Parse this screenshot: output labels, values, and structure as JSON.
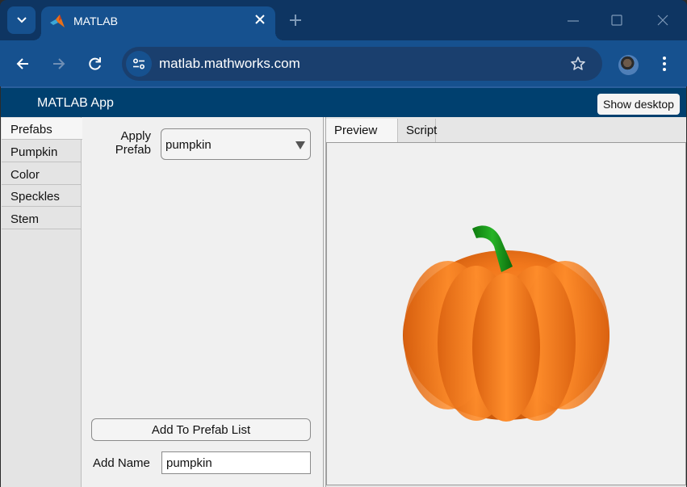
{
  "browser": {
    "tab": {
      "title": "MATLAB",
      "favicon": "matlab-logo-icon"
    },
    "url": "matlab.mathworks.com",
    "icons": {
      "tab_search": "chevron-down-icon",
      "tab_close": "close-icon",
      "new_tab": "plus-icon",
      "back": "arrow-left-icon",
      "forward": "arrow-right-icon",
      "reload": "reload-icon",
      "site_info": "tune-icon",
      "bookmark": "star-icon",
      "profile": "avatar-icon",
      "menu": "kebab-menu-icon",
      "minimize": "minimize-icon",
      "maximize": "maximize-icon",
      "close_window": "close-icon"
    }
  },
  "app": {
    "title": "MATLAB App",
    "show_desktop_label": "Show desktop",
    "left_tabs": [
      {
        "label": "Prefabs",
        "active": true
      },
      {
        "label": "Pumpkin",
        "active": false
      },
      {
        "label": "Color",
        "active": false
      },
      {
        "label": "Speckles",
        "active": false
      },
      {
        "label": "Stem",
        "active": false
      }
    ],
    "prefabs": {
      "apply_label_line1": "Apply",
      "apply_label_line2": "Prefab",
      "selected_prefab": "pumpkin",
      "add_button_label": "Add To Prefab List",
      "add_name_label": "Add Name",
      "add_name_value": "pumpkin"
    },
    "right_tabs": [
      {
        "label": "Preview",
        "active": true
      },
      {
        "label": "Script",
        "active": false
      }
    ],
    "preview": {
      "object": "pumpkin-3d-render",
      "colors": {
        "body": "#f07a1e",
        "body_shadow": "#c9560c",
        "stem": "#1a9a1a"
      }
    }
  }
}
